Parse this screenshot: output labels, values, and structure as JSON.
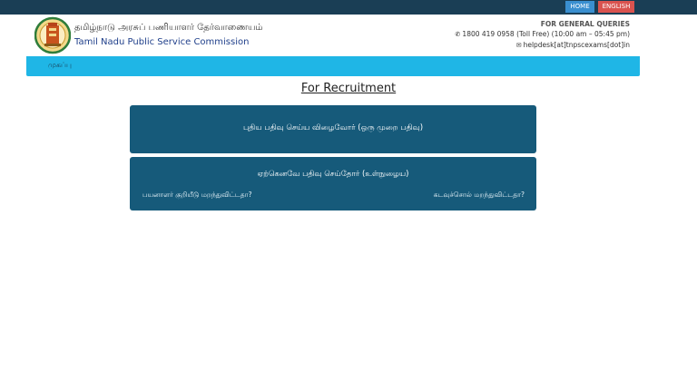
{
  "topbar": {
    "home_label": "HOME",
    "english_label": "ENGLISH"
  },
  "header": {
    "title_tamil": "தமிழ்நாடு அரசுப் பணியாளர் தேர்வாணையம்",
    "title_english": "Tamil Nadu Public Service Commission",
    "queries_title": "FOR GENERAL QUERIES",
    "phone": "1800 419 0958 (Toll Free) (10:00 am – 05:45 pm)",
    "email": "helpdesk[at]tnpscexams[dot]in"
  },
  "nav": {
    "home_label": "முகப்பு"
  },
  "main": {
    "title": "For Recruitment",
    "new_registration": "புதிய பதிவு செய்ய விழைவோர் (ஒரு முறை பதிவு)",
    "existing_login": "ஏற்கெனவே பதிவு செய்தோர் (உள்நுழைய)",
    "forgot_userid": "பயனாளர் குறியீடு மறந்துவிட்டதா?",
    "forgot_password": "கடவுச்சொல் மறந்துவிட்டதா?"
  },
  "colors": {
    "topbar": "#1a3e55",
    "nav": "#1fb6e6",
    "card": "#165a7a",
    "home_btn": "#3a8fd0",
    "english_btn": "#d9534f"
  }
}
